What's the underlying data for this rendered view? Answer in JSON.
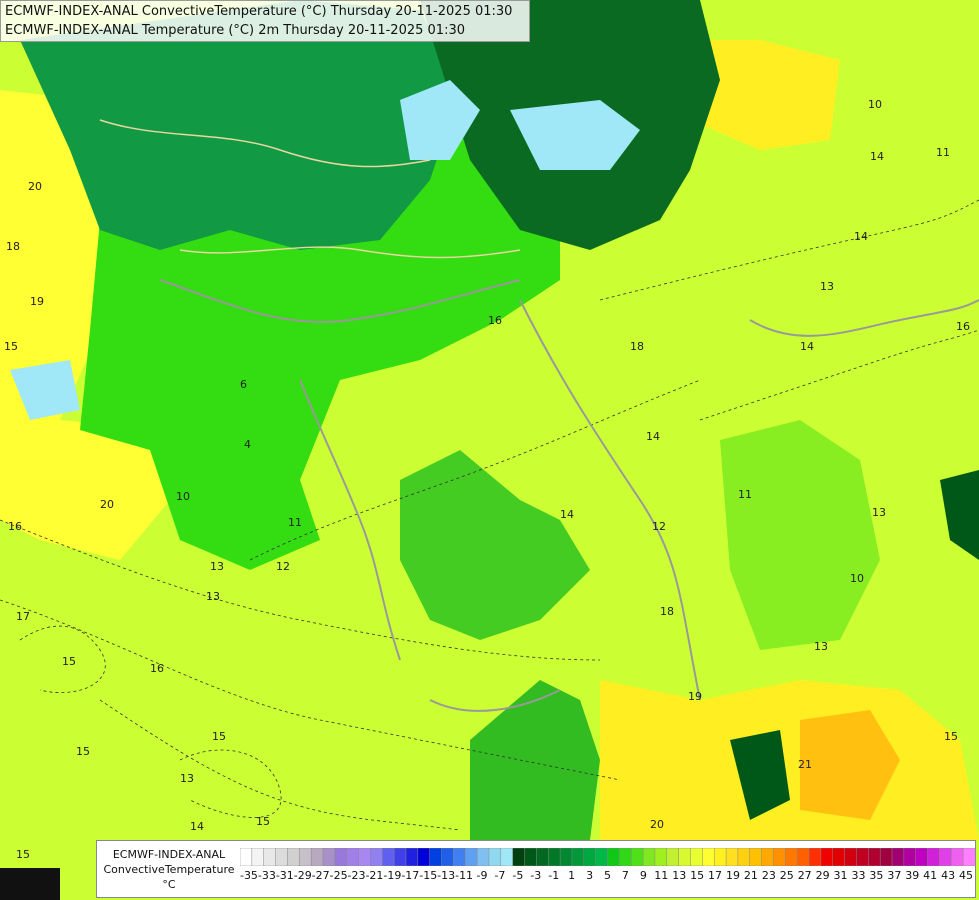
{
  "title_lines": [
    "ECMWF-INDEX-ANAL ConvectiveTemperature (°C) Thursday 20-11-2025 01:30",
    "ECMWF-INDEX-ANAL Temperature (°C) 2m Thursday 20-11-2025 01:30"
  ],
  "legend": {
    "model": "ECMWF-INDEX-ANAL",
    "parameter": "ConvectiveTemperature",
    "unit": "°C",
    "tick_labels": [
      "-35",
      "-33",
      "-31",
      "-29",
      "-27",
      "-25",
      "-23",
      "-21",
      "-19",
      "-17",
      "-15",
      "-13",
      "-11",
      "-9",
      "-7",
      "-5",
      "-3",
      "-1",
      "1",
      "3",
      "5",
      "7",
      "9",
      "11",
      "13",
      "15",
      "17",
      "19",
      "21",
      "23",
      "25",
      "27",
      "29",
      "31",
      "33",
      "35",
      "37",
      "39",
      "41",
      "43",
      "45"
    ],
    "colors": [
      "#ffffff",
      "#f4f4f4",
      "#e8e8e8",
      "#dcdcdc",
      "#d0d0d0",
      "#c8c0c8",
      "#b8a8c0",
      "#a890c8",
      "#9878d8",
      "#a080e8",
      "#a888f0",
      "#9080f0",
      "#6060f0",
      "#4040e8",
      "#2020e0",
      "#0000d8",
      "#0040e0",
      "#2060e8",
      "#4080f0",
      "#60a0f0",
      "#80c0f0",
      "#90d8f0",
      "#a0e8f8",
      "#004010",
      "#005818",
      "#006820",
      "#007828",
      "#008830",
      "#009838",
      "#00a840",
      "#00b848",
      "#10c818",
      "#30d818",
      "#50e018",
      "#80e820",
      "#a0f020",
      "#c0f030",
      "#d8f830",
      "#e8ff30",
      "#ffff30",
      "#fff020",
      "#ffe020",
      "#ffd010",
      "#ffc000",
      "#ffa800",
      "#ff9000",
      "#ff7800",
      "#ff6000",
      "#ff3000",
      "#f00000",
      "#e00000",
      "#d00010",
      "#c00020",
      "#b00030",
      "#a00040",
      "#a00070",
      "#b000a0",
      "#c000c0",
      "#d020d8",
      "#e040e8",
      "#f060f0",
      "#ff80ff"
    ]
  },
  "contour_labels": [
    "20",
    "18",
    "19",
    "15",
    "20",
    "16",
    "17",
    "15",
    "16",
    "15",
    "13",
    "14",
    "15",
    "15",
    "4",
    "6",
    "10",
    "11",
    "12",
    "13",
    "16",
    "14",
    "18",
    "14",
    "12",
    "18",
    "19",
    "21",
    "20",
    "13",
    "10",
    "14",
    "11",
    "14",
    "13",
    "16",
    "14",
    "13",
    "11",
    "10",
    "15",
    "13",
    "15"
  ]
}
